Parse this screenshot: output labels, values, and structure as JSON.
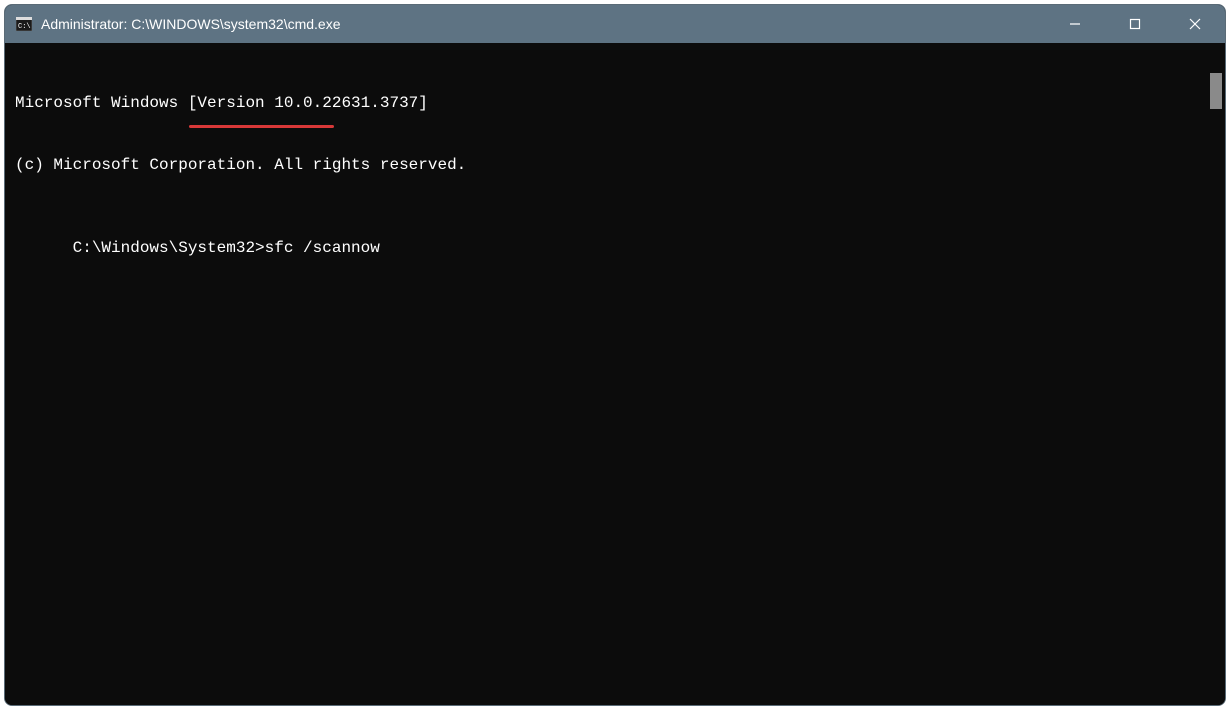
{
  "window": {
    "title": "Administrator: C:\\WINDOWS\\system32\\cmd.exe",
    "icon_name": "cmd-icon"
  },
  "terminal": {
    "lines": [
      "Microsoft Windows [Version 10.0.22631.3737]",
      "(c) Microsoft Corporation. All rights reserved.",
      "",
      "C:\\Windows\\System32>sfc /scannow"
    ],
    "prompt": "C:\\Windows\\System32>",
    "command": "sfc /scannow"
  },
  "annotation": {
    "underline_color": "#d83838"
  }
}
